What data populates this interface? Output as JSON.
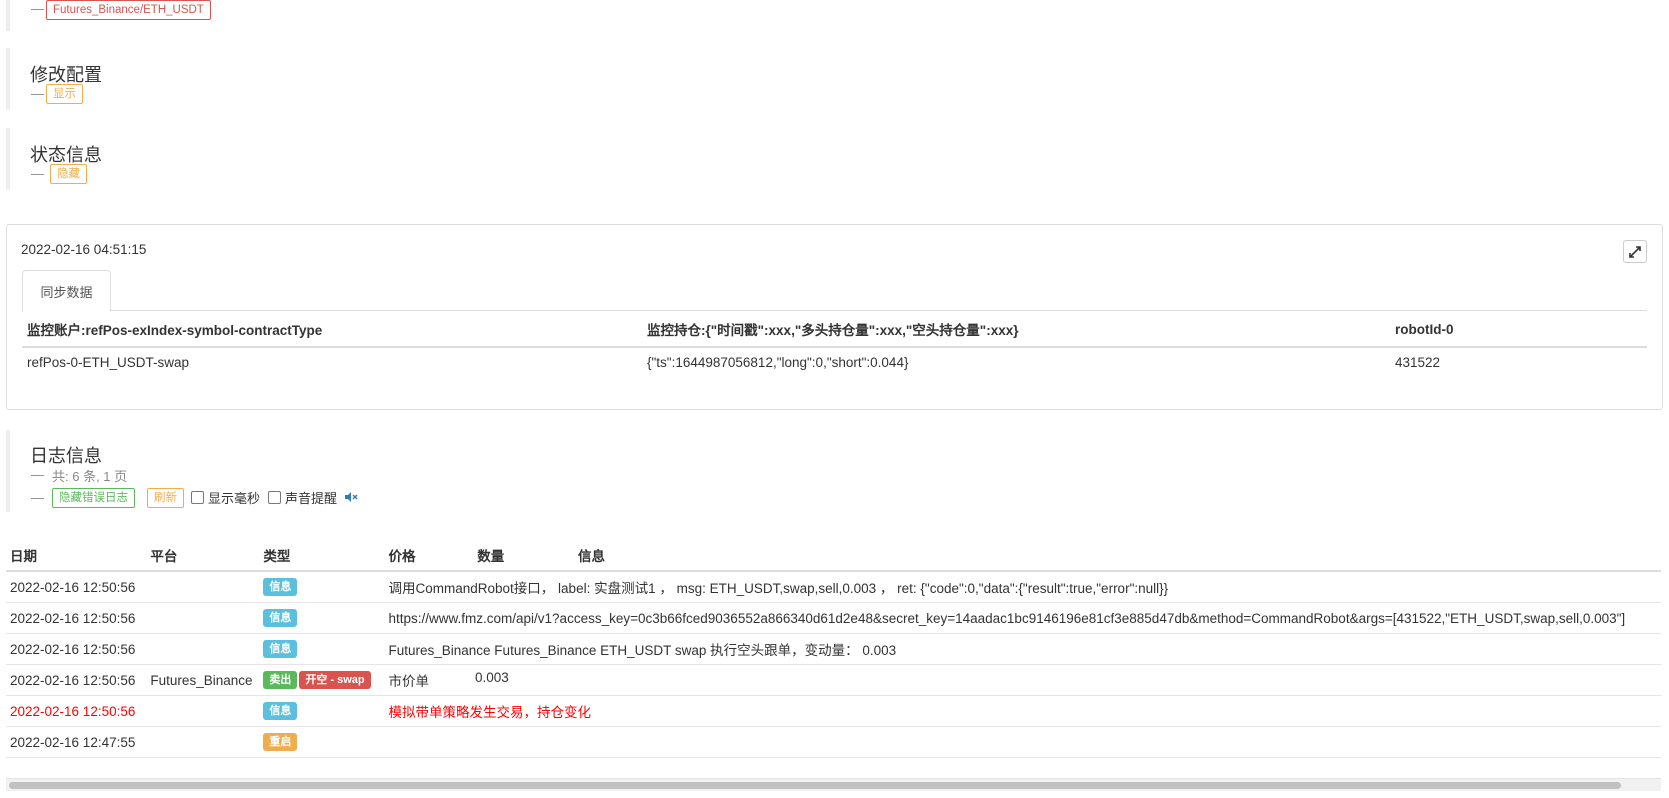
{
  "top_section": {
    "tag": "Futures_Binance/ETH_USDT"
  },
  "modify_config": {
    "title": "修改配置",
    "toggle": "显示"
  },
  "status_info": {
    "title": "状态信息",
    "toggle": "隐藏"
  },
  "status_panel": {
    "timestamp": "2022-02-16 04:51:15",
    "tab": "同步数据",
    "columns": [
      "监控账户:refPos-exIndex-symbol-contractType",
      "监控持仓:{\"时间戳\":xxx,\"多头持仓量\":xxx,\"空头持仓量\":xxx}",
      "robotId-0"
    ],
    "rows": [
      [
        "refPos-0-ETH_USDT-swap",
        "{\"ts\":1644987056812,\"long\":0,\"short\":0.044}",
        "431522"
      ]
    ]
  },
  "log_info": {
    "title": "日志信息",
    "summary": "共: 6 条, 1 页",
    "hide_errors": "隐藏错误日志",
    "refresh": "刷新",
    "show_ms": "显示毫秒",
    "sound_alert": "声音提醒",
    "icon": "speaker-muted-icon"
  },
  "log_table": {
    "columns": [
      "日期",
      "平台",
      "类型",
      "价格",
      "数量",
      "信息"
    ],
    "rows": [
      {
        "date": "2022-02-16 12:50:56",
        "platform": "",
        "labels": [
          "信息"
        ],
        "price": "调用CommandRobot接口， label: 实盘测试1 ， msg: ETH_USDT,swap,sell,0.003 ， ret: {\"code\":0,\"data\":{\"result\":true,\"error\":null}}",
        "amount": "",
        "info": ""
      },
      {
        "date": "2022-02-16 12:50:56",
        "platform": "",
        "labels": [
          "信息"
        ],
        "price": "https://www.fmz.com/api/v1?access_key=0c3b66fced9036552a866340d61d2e48&secret_key=14aadac1bc9146196e81cf3e885d47db&method=CommandRobot&args=[431522,\"ETH_USDT,swap,sell,0.003\"]",
        "amount": "",
        "info": ""
      },
      {
        "date": "2022-02-16 12:50:56",
        "platform": "",
        "labels": [
          "信息"
        ],
        "price": "Futures_Binance Futures_Binance ETH_USDT swap 执行空头跟单，变动量： 0.003",
        "amount": "",
        "info": ""
      },
      {
        "date": "2022-02-16 12:50:56",
        "platform": "Futures_Binance",
        "labels": [
          "卖出",
          "开空 - swap"
        ],
        "price": "市价单",
        "amount": "0.003",
        "info": ""
      },
      {
        "date": "2022-02-16 12:50:56",
        "platform": "",
        "labels": [
          "信息"
        ],
        "price": "模拟带单策略发生交易，持仓变化",
        "amount": "",
        "info": "",
        "highlight": true
      },
      {
        "date": "2022-02-16 12:47:55",
        "platform": "",
        "labels": [
          "重启"
        ],
        "price": "",
        "amount": "",
        "info": ""
      }
    ]
  },
  "colors": {
    "info": "#5bc0de",
    "sell": "#5cb85c",
    "open_short": "#d9534f",
    "restart": "#f0ad4e",
    "error_text": "#ff0000"
  }
}
